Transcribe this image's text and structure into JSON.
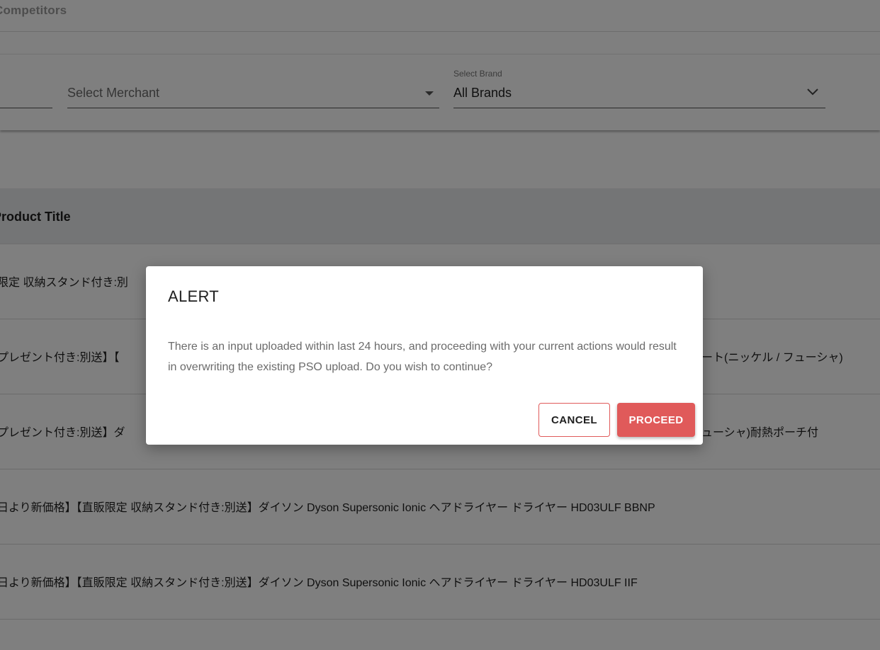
{
  "section": {
    "title": "Competitors"
  },
  "filters": {
    "merchant": {
      "value": "Select Merchant",
      "icon": "caret-down-icon"
    },
    "brand": {
      "label": "Select Brand",
      "value": "All Brands",
      "icon": "chevron-down-icon"
    }
  },
  "table": {
    "header": "Product Title",
    "rows": [
      {
        "left": "限定 収納スタンド付き:別",
        "right": ""
      },
      {
        "left": "プレゼント付き:別送】【",
        "right": "ート(ニッケル / フューシャ)"
      },
      {
        "left": "プレゼント付き:別送】ダ",
        "right": "ューシャ)耐熱ポーチ付"
      },
      {
        "left": "日より新価格】【直販限定 収納スタンド付き:別送】ダイソン Dyson Supersonic Ionic ヘアドライヤー ドライヤー HD03ULF BBNP",
        "right": ""
      },
      {
        "left": "日より新価格】【直販限定 収納スタンド付き:別送】ダイソン Dyson Supersonic Ionic ヘアドライヤー ドライヤー HD03ULF IIF",
        "right": ""
      }
    ]
  },
  "dialog": {
    "title": "ALERT",
    "message": "There is an input uploaded within last 24 hours, and proceeding with your current actions would result in overwriting the existing PSO upload. Do you wish to continue?",
    "cancel_label": "CANCEL",
    "proceed_label": "PROCEED"
  },
  "colors": {
    "accent": "#e05a5a",
    "overlay": "rgba(0,0,0,0.5)"
  }
}
